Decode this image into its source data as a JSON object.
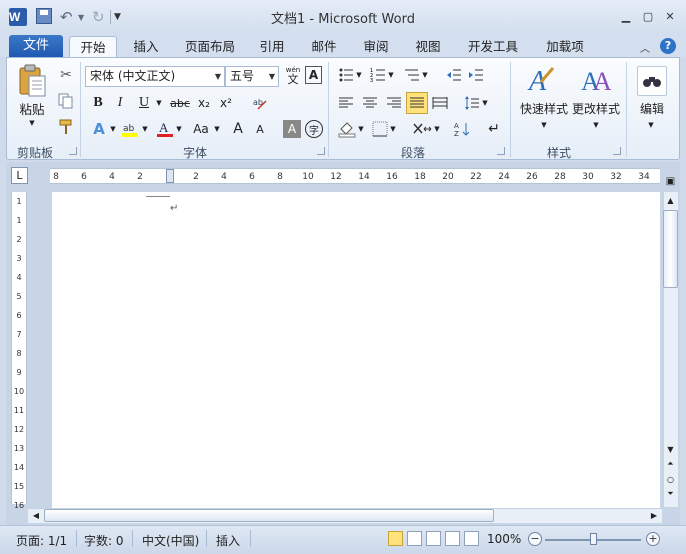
{
  "window": {
    "title": "文档1 - Microsoft Word",
    "app_icon": "W"
  },
  "quick_access": {
    "icons": [
      "save-icon",
      "undo-icon",
      "redo-icon",
      "customize-icon"
    ]
  },
  "tabs": {
    "file": "文件",
    "items": [
      "开始",
      "插入",
      "页面布局",
      "引用",
      "邮件",
      "审阅",
      "视图",
      "开发工具",
      "加载项"
    ],
    "active_index": 0
  },
  "ribbon": {
    "clipboard": {
      "paste_label": "粘贴",
      "group_label": "剪贴板"
    },
    "font": {
      "font_name": "宋体 (中文正文)",
      "font_size": "五号",
      "group_label": "字体",
      "bold": "B",
      "italic": "I",
      "underline": "U",
      "strike": "abc",
      "subscript": "x₂",
      "superscript": "x²",
      "change_case": "Aa",
      "grow_font": "A",
      "shrink_font": "A",
      "char_border": "A",
      "enclose": "字",
      "wen": "wén",
      "wen_char": "文"
    },
    "paragraph": {
      "group_label": "段落"
    },
    "styles": {
      "quick_styles": "快速样式",
      "change_styles": "更改样式",
      "group_label": "样式"
    },
    "editing": {
      "label": "编辑"
    }
  },
  "ruler": {
    "horizontal_ticks": [
      "8",
      "6",
      "4",
      "2",
      "2",
      "4",
      "6",
      "8",
      "10",
      "12",
      "14",
      "16",
      "18",
      "20",
      "22",
      "24",
      "26",
      "28",
      "30",
      "32",
      "34"
    ],
    "vertical_ticks": [
      "1",
      "1",
      "2",
      "3",
      "4",
      "5",
      "6",
      "7",
      "8",
      "9",
      "10",
      "11",
      "12",
      "13",
      "14",
      "15",
      "16"
    ],
    "toggle": "L"
  },
  "statusbar": {
    "page": "页面: 1/1",
    "words": "字数: 0",
    "language": "中文(中国)",
    "insert_mode": "插入",
    "zoom": "100%"
  },
  "colors": {
    "file_tab": "#2b5cab",
    "highlight": "#ffff00",
    "font_color": "#e02020",
    "active_view": "#ffe27a"
  }
}
